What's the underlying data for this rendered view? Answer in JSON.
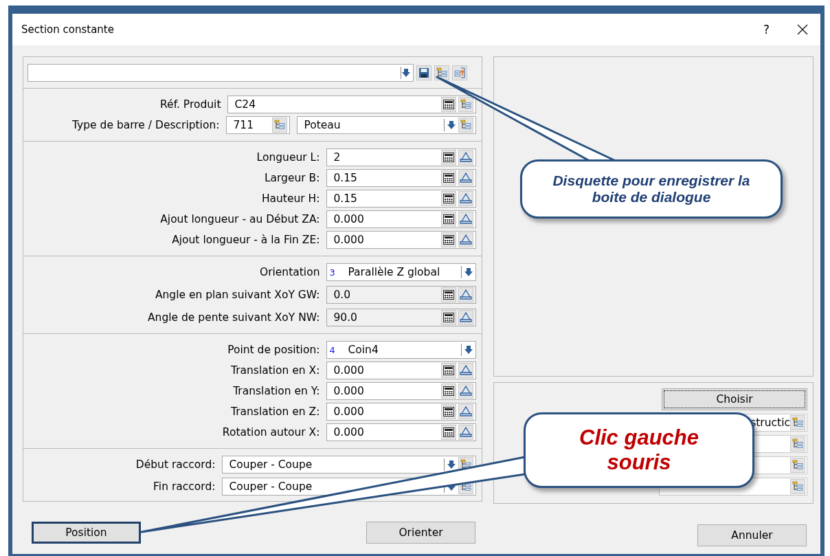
{
  "window": {
    "title": "Section constante",
    "help": "?"
  },
  "sections": [
    {
      "kind": "product",
      "rows": [
        {
          "kind": "product",
          "label": "Réf. Produit",
          "value": "C24"
        },
        {
          "kind": "bar_type",
          "label": "Type de barre / Description:",
          "code": "711",
          "value": "Poteau"
        }
      ]
    },
    {
      "kind": "dimensions",
      "rows": [
        {
          "kind": "number",
          "label": "Longueur L:",
          "value": "2",
          "disabled": false
        },
        {
          "kind": "number",
          "label": "Largeur B:",
          "value": "0.15",
          "disabled": false
        },
        {
          "kind": "number",
          "label": "Hauteur H:",
          "value": "0.15",
          "disabled": false
        },
        {
          "kind": "number",
          "label": "Ajout longueur - au Début ZA:",
          "value": "0.000",
          "disabled": false
        },
        {
          "kind": "number",
          "label": "Ajout longueur - à la Fin ZE:",
          "value": "0.000",
          "disabled": false
        }
      ]
    },
    {
      "kind": "orientation",
      "rows": [
        {
          "kind": "enum",
          "label": "Orientation",
          "code": "3",
          "value": "Parallèle Z global"
        },
        {
          "kind": "number",
          "label": "Angle en plan suivant XoY GW:",
          "value": "0.0",
          "disabled": true
        },
        {
          "kind": "number",
          "label": "Angle de pente suivant XoY NW:",
          "value": "90.0",
          "disabled": true
        }
      ]
    },
    {
      "kind": "position",
      "rows": [
        {
          "kind": "enum",
          "label": "Point de position:",
          "code": "4",
          "value": "Coin4"
        },
        {
          "kind": "number",
          "label": "Translation en X:",
          "value": "0.000",
          "disabled": false
        },
        {
          "kind": "number",
          "label": "Translation en Y:",
          "value": "0.000",
          "disabled": false
        },
        {
          "kind": "number",
          "label": "Translation en Z:",
          "value": "0.000",
          "disabled": false
        },
        {
          "kind": "number",
          "label": "Rotation autour X:",
          "value": "0.000",
          "disabled": false
        }
      ]
    },
    {
      "kind": "connection",
      "rows": [
        {
          "kind": "connection",
          "label": "Début raccord:",
          "value": "Couper - Coupe"
        },
        {
          "kind": "connection",
          "label": "Fin raccord:",
          "value": "Couper - Coupe"
        }
      ]
    }
  ],
  "side_panel": {
    "button": {
      "label": "Choisir",
      "focused": true
    },
    "fields": [
      {
        "kind": "filled",
        "value": "structic"
      },
      {
        "kind": "empty"
      },
      {
        "kind": "empty"
      },
      {
        "kind": "empty"
      }
    ]
  },
  "buttons": [
    {
      "label": "Position",
      "highlighted": true
    },
    {
      "label": "Orienter",
      "highlighted": false
    },
    {
      "label": "Annuler",
      "highlighted": false
    }
  ],
  "callouts": [
    {
      "kind": "info",
      "text": "Disquette pour enregistrer la boite de dialogue"
    },
    {
      "kind": "action",
      "text": "Clic gauche souris"
    }
  ]
}
